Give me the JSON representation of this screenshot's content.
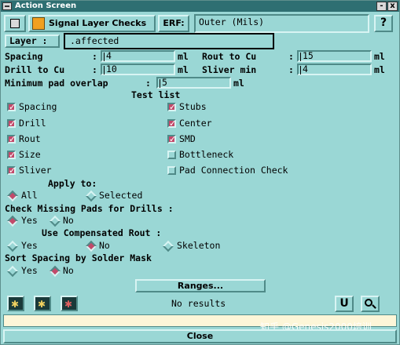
{
  "window": {
    "title": "Action Screen",
    "minimize": "-",
    "close": "x"
  },
  "header": {
    "title": "Signal Layer Checks",
    "erf_label": "ERF:",
    "erf_value": "Outer (Mils)",
    "help_label": "?"
  },
  "layer": {
    "label": "Layer :",
    "value": ".affected"
  },
  "params": {
    "spacing": {
      "label": "Spacing",
      "colon": ":",
      "value": "4",
      "unit": "ml"
    },
    "rout_to_cu": {
      "label": "Rout to Cu",
      "colon": ":",
      "value": "15",
      "unit": "ml"
    },
    "drill_to_cu": {
      "label": "Drill to Cu",
      "colon": ":",
      "value": "10",
      "unit": "ml"
    },
    "sliver_min": {
      "label": "Sliver min",
      "colon": ":",
      "value": "4",
      "unit": "ml"
    },
    "min_pad_overlap": {
      "label": "Minimum pad overlap",
      "colon": ":",
      "value": "5",
      "unit": "ml"
    }
  },
  "test_list": {
    "title": "Test list",
    "items": [
      {
        "label": "Spacing",
        "checked": true
      },
      {
        "label": "Stubs",
        "checked": true
      },
      {
        "label": "Drill",
        "checked": true
      },
      {
        "label": "Center",
        "checked": true
      },
      {
        "label": "Rout",
        "checked": true
      },
      {
        "label": "SMD",
        "checked": true
      },
      {
        "label": "Size",
        "checked": true
      },
      {
        "label": "Bottleneck",
        "checked": false
      },
      {
        "label": "Sliver",
        "checked": true
      },
      {
        "label": "Pad Connection Check",
        "checked": false
      }
    ]
  },
  "apply_to": {
    "label": "Apply to:",
    "options": [
      "All",
      "Selected"
    ],
    "selected": "All"
  },
  "missing_pads": {
    "label": "Check Missing Pads for Drills :",
    "options": [
      "Yes",
      "No"
    ],
    "selected": "Yes"
  },
  "comp_rout": {
    "label": "Use Compensated Rout :",
    "options": [
      "Yes",
      "No",
      "Skeleton"
    ],
    "selected": "No"
  },
  "sort_spacing": {
    "label": "Sort Spacing by Solder Mask",
    "options": [
      "Yes",
      "No"
    ],
    "selected": "No"
  },
  "ranges_button": "Ranges...",
  "status": {
    "text": "No results",
    "u_button": "U",
    "zoom_icon": "magnifier-icon"
  },
  "tools": [
    "run-icon",
    "run-selected-icon",
    "run-results-icon"
  ],
  "close_button": "Close",
  "watermark": "知乎 @Genesis2000培训",
  "colors": {
    "background": "#9ad7d5",
    "titlebar": "#2e6f72",
    "checked": "#c2496a"
  }
}
